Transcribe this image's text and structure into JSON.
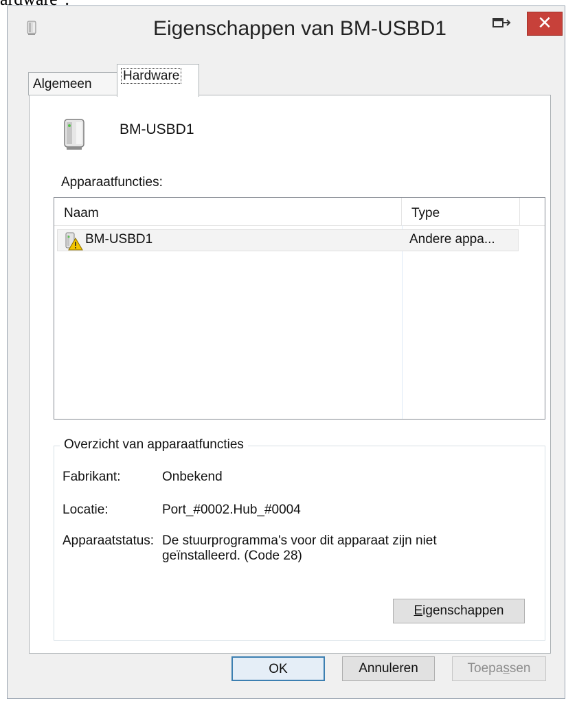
{
  "top_caption": "ardware\".",
  "window": {
    "title": "Eigenschappen van BM-USBD1",
    "close_glyph": "✕"
  },
  "tabs": [
    {
      "label": "Algemeen",
      "active": false
    },
    {
      "label": "Hardware",
      "active": true
    }
  ],
  "device": {
    "name": "BM-USBD1",
    "icon": "device-tower-icon"
  },
  "functions": {
    "label": "Apparaatfuncties:",
    "columns": [
      "Naam",
      "Type"
    ],
    "rows": [
      {
        "name": "BM-USBD1",
        "type": "Andere appa...",
        "icon": "device-warning-icon"
      }
    ]
  },
  "summary": {
    "legend": "Overzicht van apparaatfuncties",
    "manufacturer_label": "Fabrikant:",
    "manufacturer_value": "Onbekend",
    "location_label": "Locatie:",
    "location_value": "Port_#0002.Hub_#0004",
    "status_label": "Apparaatstatus:",
    "status_line1": "De stuurprogramma's voor dit apparaat zijn niet",
    "status_line2": "geïnstalleerd. (Code 28)",
    "properties_button": {
      "first": "E",
      "rest": "igenschappen"
    }
  },
  "footer": {
    "ok": "OK",
    "cancel": "Annuleren",
    "apply": {
      "before": "Toepa",
      "accel": "s",
      "after": "sen"
    }
  },
  "colors": {
    "close_button": "#c7413a",
    "focus_border": "#3c7fb1",
    "warning": "#f2c500"
  }
}
